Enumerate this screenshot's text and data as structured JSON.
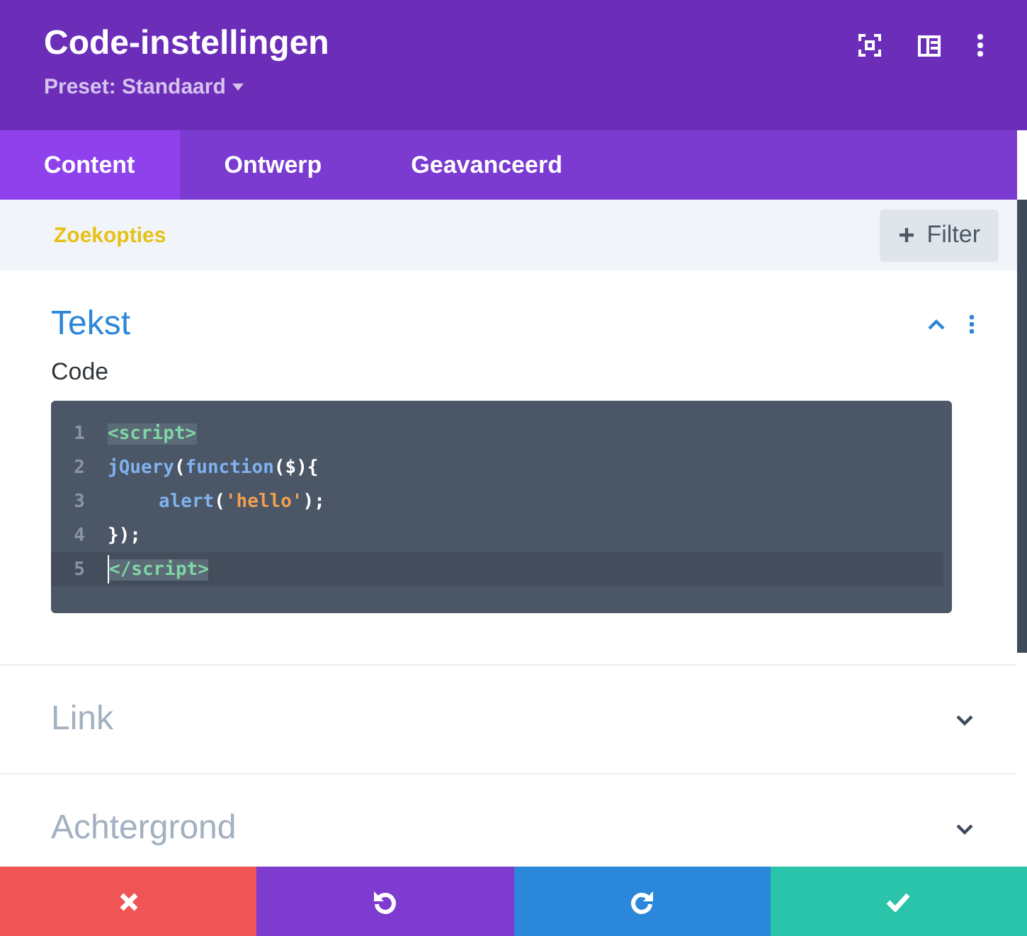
{
  "header": {
    "title": "Code-instellingen",
    "preset": "Preset: Standaard"
  },
  "tabs": [
    {
      "label": "Content",
      "selected": true
    },
    {
      "label": "Ontwerp",
      "selected": false
    },
    {
      "label": "Geavanceerd",
      "selected": false
    }
  ],
  "search": {
    "placeholder": "Zoekopties",
    "filter_button": "Filter"
  },
  "sections": [
    {
      "title": "Tekst",
      "expanded": true,
      "field_label": "Code",
      "code_lines": [
        {
          "number": "1",
          "indented": false,
          "current": false,
          "tokens": [
            {
              "text": "<script>",
              "kind": "tag-match"
            }
          ]
        },
        {
          "number": "2",
          "indented": false,
          "current": false,
          "tokens": [
            {
              "text": "jQuery",
              "kind": "name"
            },
            {
              "text": "(",
              "kind": "plain"
            },
            {
              "text": "function",
              "kind": "name"
            },
            {
              "text": "($){",
              "kind": "plain"
            }
          ]
        },
        {
          "number": "3",
          "indented": true,
          "current": false,
          "tokens": [
            {
              "text": "alert",
              "kind": "name"
            },
            {
              "text": "(",
              "kind": "plain"
            },
            {
              "text": "'hello'",
              "kind": "string"
            },
            {
              "text": ");",
              "kind": "plain"
            }
          ]
        },
        {
          "number": "4",
          "indented": false,
          "current": false,
          "tokens": [
            {
              "text": "});",
              "kind": "plain"
            }
          ]
        },
        {
          "number": "5",
          "indented": false,
          "current": true,
          "tokens": [
            {
              "text": "</script>",
              "kind": "tag-match"
            }
          ]
        }
      ]
    },
    {
      "title": "Link",
      "expanded": false
    },
    {
      "title": "Achtergrond",
      "expanded": false
    }
  ],
  "footer": [
    {
      "kind": "cancel"
    },
    {
      "kind": "undo"
    },
    {
      "kind": "redo"
    },
    {
      "kind": "save"
    }
  ]
}
